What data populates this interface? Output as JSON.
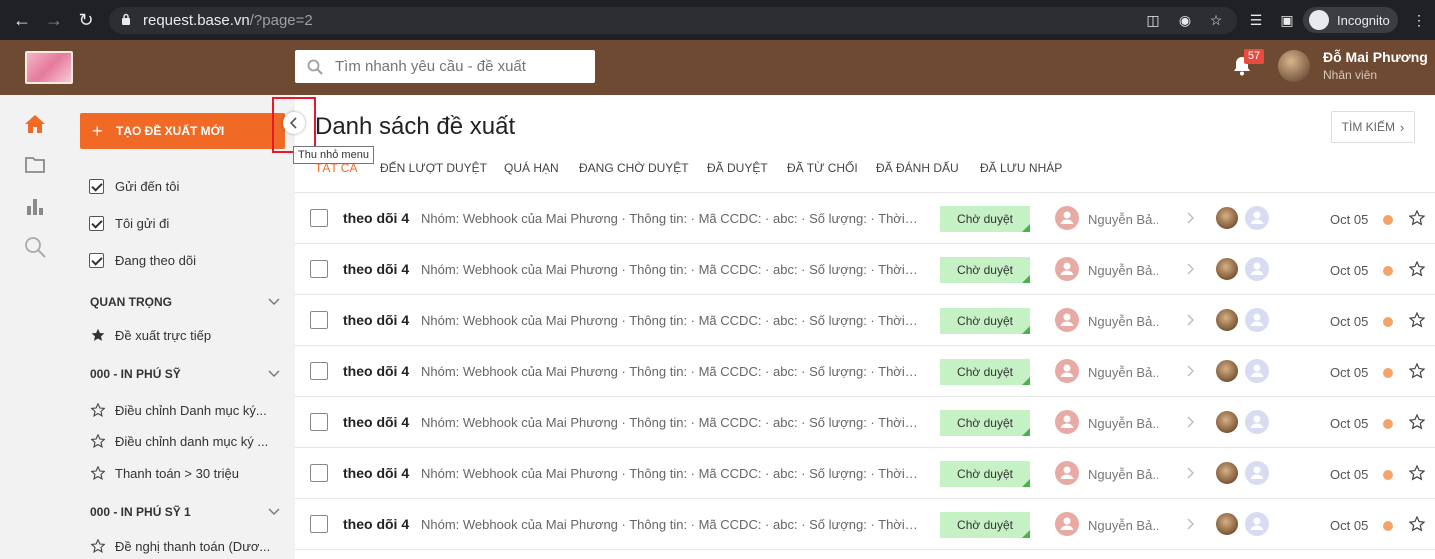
{
  "browser": {
    "url_host": "request.base.vn",
    "url_path": "/?page=2",
    "profile_label": "Incognito"
  },
  "header": {
    "search_placeholder": "Tìm nhanh yêu cầu - đề xuất",
    "notification_count": "57",
    "user_name": "Đỗ Mai Phương",
    "user_role": "Nhân viên"
  },
  "sidebar": {
    "create_button": "TẠO ĐỀ XUẤT MỚI",
    "filters": [
      {
        "label": "Gửi đến tôi",
        "checked": true
      },
      {
        "label": "Tôi gửi đi",
        "checked": true
      },
      {
        "label": "Đang theo dõi",
        "checked": true
      }
    ],
    "sections": [
      {
        "title": "QUAN TRỌNG",
        "items": [
          "Đề xuất trực tiếp"
        ]
      },
      {
        "title": "000 - IN PHÚ SỸ",
        "items": [
          "Điều chỉnh Danh mục ký...",
          "Điều chỉnh danh mục ký ...",
          "Thanh toán > 30 triệu"
        ]
      },
      {
        "title": "000 - IN PHÚ SỸ 1",
        "items": [
          "Đề nghị thanh toán (Dươ..."
        ]
      }
    ]
  },
  "tooltip": "Thu nhỏ menu",
  "main": {
    "title": "Danh sách đề xuất",
    "find_button": "TÌM KIẾM",
    "tabs": [
      "TẤT CẢ",
      "ĐẾN LƯỢT DUYỆT",
      "QUÁ HẠN",
      "ĐANG CHỜ DUYỆT",
      "ĐÃ DUYỆT",
      "ĐÃ TỪ CHỐI",
      "ĐÃ ĐÁNH DẤU",
      "ĐÃ LƯU NHÁP"
    ],
    "active_tab": "TẤT CẢ",
    "rows": [
      {
        "title": "theo dõi 4",
        "desc": "Nhóm: Webhook của Mai Phương · Thông tin: · Mã CCDC: · abc: · Số lượng: · Thời hạn...",
        "status": "Chờ duyệt",
        "person": "Nguyễn Bả...",
        "date": "Oct 05"
      },
      {
        "title": "theo dõi 4",
        "desc": "Nhóm: Webhook của Mai Phương · Thông tin: · Mã CCDC: · abc: · Số lượng: · Thời hạn...",
        "status": "Chờ duyệt",
        "person": "Nguyễn Bả...",
        "date": "Oct 05"
      },
      {
        "title": "theo dõi 4",
        "desc": "Nhóm: Webhook của Mai Phương · Thông tin: · Mã CCDC: · abc: · Số lượng: · Thời hạn...",
        "status": "Chờ duyệt",
        "person": "Nguyễn Bả...",
        "date": "Oct 05"
      },
      {
        "title": "theo dõi 4",
        "desc": "Nhóm: Webhook của Mai Phương · Thông tin: · Mã CCDC: · abc: · Số lượng: · Thời hạn...",
        "status": "Chờ duyệt",
        "person": "Nguyễn Bả...",
        "date": "Oct 05"
      },
      {
        "title": "theo dõi 4",
        "desc": "Nhóm: Webhook của Mai Phương · Thông tin: · Mã CCDC: · abc: · Số lượng: · Thời hạn...",
        "status": "Chờ duyệt",
        "person": "Nguyễn Bả...",
        "date": "Oct 05"
      },
      {
        "title": "theo dõi 4",
        "desc": "Nhóm: Webhook của Mai Phương · Thông tin: · Mã CCDC: · abc: · Số lượng: · Thời hạn...",
        "status": "Chờ duyệt",
        "person": "Nguyễn Bả...",
        "date": "Oct 05"
      },
      {
        "title": "theo dõi 4",
        "desc": "Nhóm: Webhook của Mai Phương · Thông tin: · Mã CCDC: · abc: · Số lượng: · Thời hạn...",
        "status": "Chờ duyệt",
        "person": "Nguyễn Bả...",
        "date": "Oct 05"
      }
    ]
  },
  "colors": {
    "accent": "#f06a25",
    "header_bg": "#6f4a33",
    "status_bg": "#c6f1c4",
    "highlight": "#e8182c"
  }
}
